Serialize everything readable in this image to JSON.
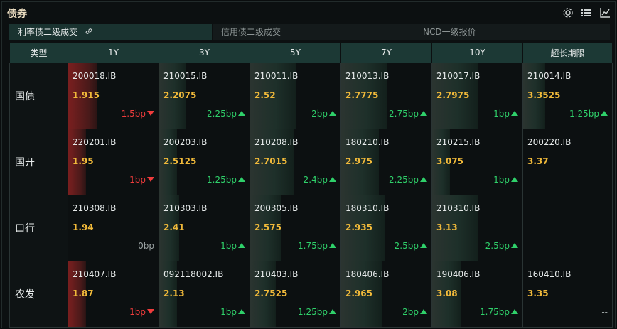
{
  "title": "债券",
  "icons": [
    "gear-icon",
    "list-icon",
    "chart-icon"
  ],
  "tabs": [
    {
      "label": "利率债二级成交",
      "active": true
    },
    {
      "label": "信用债二级成交",
      "active": false
    },
    {
      "label": "NCD一级报价",
      "active": false
    }
  ],
  "columns": [
    "类型",
    "1Y",
    "3Y",
    "5Y",
    "7Y",
    "10Y",
    "超长期限"
  ],
  "colors": {
    "up": "#2fd06a",
    "down": "#f03c3c",
    "yield": "#f0b93a",
    "accent": "#1c3935"
  },
  "rows": [
    {
      "type": "国债",
      "cells": [
        {
          "code": "200018.IB",
          "yield": "1.915",
          "change": "1.5bp",
          "dir": "down",
          "level": 0.32
        },
        {
          "code": "210015.IB",
          "yield": "2.2075",
          "change": "2.25bp",
          "dir": "up",
          "level": 0.3
        },
        {
          "code": "210011.IB",
          "yield": "2.52",
          "change": "2bp",
          "dir": "up",
          "level": 0.5
        },
        {
          "code": "210013.IB",
          "yield": "2.7775",
          "change": "2.75bp",
          "dir": "up",
          "level": 0.5
        },
        {
          "code": "210017.IB",
          "yield": "2.7975",
          "change": "1bp",
          "dir": "up",
          "level": 0.5
        },
        {
          "code": "210014.IB",
          "yield": "3.3525",
          "change": "1.25bp",
          "dir": "up",
          "level": 0.25
        }
      ]
    },
    {
      "type": "国开",
      "cells": [
        {
          "code": "220201.IB",
          "yield": "1.95",
          "change": "1bp",
          "dir": "down",
          "level": 0.2
        },
        {
          "code": "200203.IB",
          "yield": "2.5125",
          "change": "1.25bp",
          "dir": "up",
          "level": 0.2
        },
        {
          "code": "210208.IB",
          "yield": "2.7015",
          "change": "2.4bp",
          "dir": "up",
          "level": 0.48
        },
        {
          "code": "180210.IB",
          "yield": "2.975",
          "change": "2.25bp",
          "dir": "up",
          "level": 0.42
        },
        {
          "code": "210215.IB",
          "yield": "3.075",
          "change": "1bp",
          "dir": "up",
          "level": 0.2
        },
        {
          "code": "200220.IB",
          "yield": "3.37",
          "change": "--",
          "dir": "flat",
          "level": 0.0
        }
      ]
    },
    {
      "type": "口行",
      "cells": [
        {
          "code": "210308.IB",
          "yield": "1.94",
          "change": "0bp",
          "dir": "flat",
          "level": 0.0
        },
        {
          "code": "210303.IB",
          "yield": "2.41",
          "change": "1bp",
          "dir": "up",
          "level": 0.22
        },
        {
          "code": "200305.IB",
          "yield": "2.575",
          "change": "1.75bp",
          "dir": "up",
          "level": 0.35
        },
        {
          "code": "180310.IB",
          "yield": "2.935",
          "change": "2.5bp",
          "dir": "up",
          "level": 0.48
        },
        {
          "code": "210310.IB",
          "yield": "3.13",
          "change": "2.5bp",
          "dir": "up",
          "level": 0.5
        },
        {
          "code": "",
          "yield": "",
          "change": "",
          "dir": "flat",
          "level": 0.0
        }
      ]
    },
    {
      "type": "农发",
      "cells": [
        {
          "code": "210407.IB",
          "yield": "1.87",
          "change": "1bp",
          "dir": "down",
          "level": 0.2
        },
        {
          "code": "092118002.IB",
          "yield": "2.13",
          "change": "1bp",
          "dir": "up",
          "level": 0.2
        },
        {
          "code": "210403.IB",
          "yield": "2.7525",
          "change": "1.25bp",
          "dir": "up",
          "level": 0.28
        },
        {
          "code": "180406.IB",
          "yield": "2.965",
          "change": "2bp",
          "dir": "up",
          "level": 0.45
        },
        {
          "code": "190406.IB",
          "yield": "3.08",
          "change": "1.75bp",
          "dir": "up",
          "level": 0.32
        },
        {
          "code": "160410.IB",
          "yield": "3.35",
          "change": "--",
          "dir": "flat",
          "level": 0.0
        }
      ]
    }
  ]
}
